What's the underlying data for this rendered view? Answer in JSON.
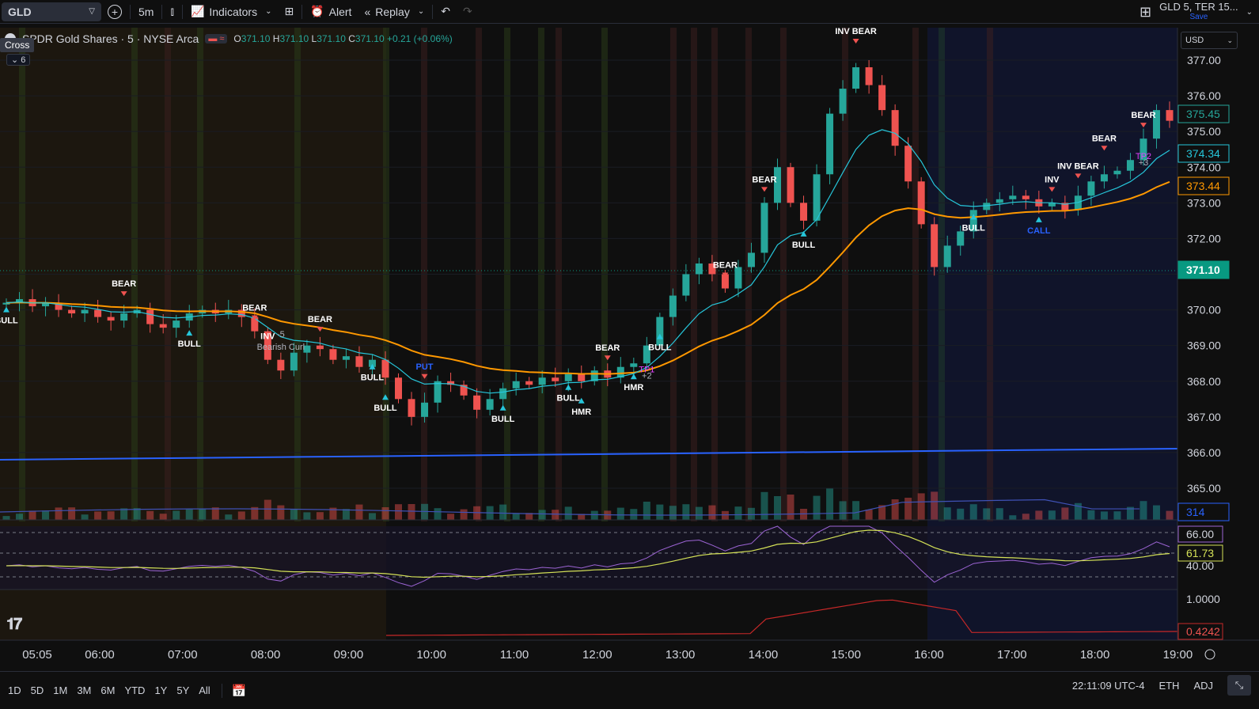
{
  "toolbar": {
    "symbol": "GLD",
    "interval": "5m",
    "indicators_label": "Indicators",
    "alert_label": "Alert",
    "replay_label": "Replay",
    "layout_name": "GLD 5, TER 15...",
    "layout_save": "Save"
  },
  "legend": {
    "title": "SPDR Gold Shares · 5 · NYSE Arca",
    "o_label": "O",
    "o": "371.10",
    "h_label": "H",
    "h": "371.10",
    "l_label": "L",
    "l": "371.10",
    "c_label": "C",
    "c": "371.10",
    "change": "+0.21 (+0.06%)",
    "cross": "Cross",
    "collapsed_count": "6"
  },
  "currency": "USD",
  "bottom": {
    "ranges": [
      "1D",
      "5D",
      "1M",
      "3M",
      "6M",
      "YTD",
      "1Y",
      "5Y",
      "All"
    ],
    "time": "22:11:09 UTC-4",
    "session": "ETH",
    "adj": "ADJ"
  },
  "colors": {
    "up": "#26a69a",
    "down": "#ef5350",
    "ema_fast": "#26c6da",
    "ema_slow": "#ff9800",
    "hline": "#2962ff",
    "rsi": "#9c64d4",
    "rsi_ma": "#d4e157",
    "bull_label": "#26c6da",
    "bear_label": "#ef5350",
    "tp": "#e040fb"
  },
  "chart_data": {
    "type": "candlestick",
    "price_axis": {
      "min": 365.0,
      "max": 377.0,
      "ticks": [
        "377.00",
        "376.00",
        "375.00",
        "374.00",
        "373.00",
        "372.00",
        "371.00",
        "370.00",
        "369.00",
        "368.00",
        "367.00",
        "366.00",
        "365.00"
      ]
    },
    "time_axis": {
      "ticks": [
        "05:05",
        "06:00",
        "07:00",
        "08:00",
        "09:00",
        "10:00",
        "11:00",
        "12:00",
        "13:00",
        "14:00",
        "15:00",
        "16:00",
        "17:00",
        "18:00",
        "19:00"
      ]
    },
    "price_labels": [
      {
        "value": "375.45",
        "color": "#26a69a"
      },
      {
        "value": "374.34",
        "color": "#26c6da"
      },
      {
        "value": "373.44",
        "color": "#ff9800"
      },
      {
        "value": "371.10",
        "color": "#089981"
      },
      {
        "value": "314",
        "color": "#2962ff"
      }
    ],
    "close_series": [
      370.2,
      370.3,
      370.1,
      370.2,
      370.0,
      369.9,
      370.0,
      369.8,
      369.7,
      369.9,
      370.0,
      369.6,
      369.5,
      369.7,
      369.9,
      370.0,
      369.9,
      370.0,
      369.8,
      369.4,
      368.6,
      368.3,
      368.8,
      369.0,
      368.9,
      368.6,
      368.7,
      368.4,
      368.6,
      368.1,
      367.5,
      367.0,
      367.4,
      368.0,
      367.9,
      367.6,
      367.2,
      367.5,
      367.8,
      368.0,
      367.9,
      368.1,
      368.0,
      368.2,
      368.0,
      368.3,
      368.1,
      368.4,
      368.5,
      369.0,
      369.8,
      370.4,
      371.0,
      371.3,
      371.0,
      370.6,
      371.2,
      371.6,
      373.0,
      374.0,
      373.0,
      372.5,
      373.8,
      375.5,
      376.2,
      376.8,
      376.3,
      375.6,
      374.6,
      373.6,
      372.4,
      371.2,
      371.8,
      372.2,
      372.8,
      373.0,
      373.1,
      373.2,
      373.1,
      372.9,
      373.0,
      372.8,
      373.2,
      373.6,
      373.8,
      373.9,
      374.2,
      374.8,
      375.6,
      375.3
    ],
    "signals": [
      "BULL",
      "BEAR",
      "BULL",
      "BEAR",
      "BULL",
      "BULL",
      "BULL",
      "BEAR",
      "HMR",
      "BEAR",
      "HMR",
      "BULL",
      "BEAR",
      "BULL",
      "INV BEAR",
      "BULL",
      "CALL",
      "PUT",
      "INV",
      "INV BEAR",
      "BEAR",
      "BEAR",
      "BEAR",
      "BULL",
      "INV",
      "TP1",
      "+2",
      "TP2",
      "+3",
      "-5",
      "Bearish Curl"
    ],
    "rsi": {
      "upper": "66.00",
      "value": "61.73",
      "lower": "40.00"
    },
    "lower_indicator": {
      "top": "1.0000",
      "value": "0.4242"
    }
  }
}
